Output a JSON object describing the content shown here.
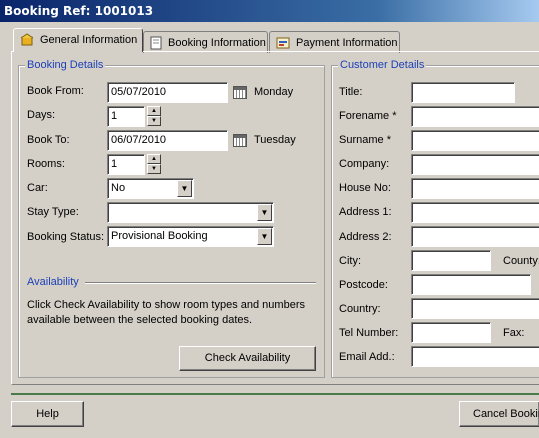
{
  "window": {
    "title": "Booking Ref: 1001013"
  },
  "tabs": [
    {
      "label": "General Information",
      "icon": "booking-icon"
    },
    {
      "label": "Booking Information",
      "icon": "document-icon"
    },
    {
      "label": "Payment Information",
      "icon": "payment-icon"
    }
  ],
  "booking": {
    "group_title": "Booking Details",
    "book_from_label": "Book From:",
    "book_from_value": "05/07/2010",
    "book_from_day": "Monday",
    "days_label": "Days:",
    "days_value": "1",
    "book_to_label": "Book To:",
    "book_to_value": "06/07/2010",
    "book_to_day": "Tuesday",
    "rooms_label": "Rooms:",
    "rooms_value": "1",
    "car_label": "Car:",
    "car_value": "No",
    "stay_type_label": "Stay Type:",
    "stay_type_value": "",
    "status_label": "Booking Status:",
    "status_value": "Provisional Booking"
  },
  "availability": {
    "title": "Availability",
    "description": "Click Check Availability to show room types and numbers available between the selected booking dates.",
    "button": "Check Availability"
  },
  "customer": {
    "group_title": "Customer Details",
    "title_label": "Title:",
    "forename_label": "Forename *",
    "surname_label": "Surname *",
    "company_label": "Company:",
    "house_label": "House No:",
    "address1_label": "Address 1:",
    "address2_label": "Address 2:",
    "city_label": "City:",
    "county_label": "County:",
    "postcode_label": "Postcode:",
    "country_label": "Country:",
    "tel_label": "Tel Number:",
    "fax_label": "Fax:",
    "email_label": "Email Add.:"
  },
  "footer": {
    "help": "Help",
    "cancel": "Cancel Booking"
  }
}
